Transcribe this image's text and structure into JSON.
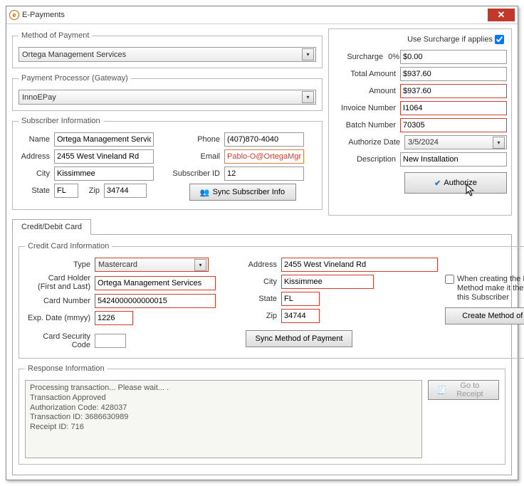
{
  "window": {
    "title": "E-Payments"
  },
  "method": {
    "legend": "Method of Payment",
    "value": "Ortega Management Services"
  },
  "gateway": {
    "legend": "Payment Processor (Gateway)",
    "value": "InnoEPay"
  },
  "subscriber": {
    "legend": "Subscriber Information",
    "name_label": "Name",
    "name": "Ortega Management Servic",
    "address_label": "Address",
    "address": "2455 West Vineland Rd",
    "city_label": "City",
    "city": "Kissimmee",
    "state_label": "State",
    "state": "FL",
    "zip_label": "Zip",
    "zip": "34744",
    "phone_label": "Phone",
    "phone": "(407)870-4040",
    "email_label": "Email",
    "email": "Pablo-O@OrtegaMgmtServ",
    "subid_label": "Subscriber ID",
    "subid": "12",
    "sync_label": "Sync Subscriber Info"
  },
  "surcharge_panel": {
    "use_label": "Use Surcharge if applies",
    "surch_label": "Surcharge",
    "surch_pct": "0%",
    "surch_amt": "$0.00",
    "total_label": "Total Amount",
    "total": "$937.60",
    "amount_label": "Amount",
    "amount": "$937.60",
    "invoice_label": "Invoice Number",
    "invoice": "I1064",
    "batch_label": "Batch Number",
    "batch": "70305",
    "authdate_label": "Authorize Date",
    "authdate": "3/5/2024",
    "desc_label": "Description",
    "desc": "New Installation",
    "authorize_label": "Authorize"
  },
  "tab": {
    "label": "Credit/Debit Card"
  },
  "cc": {
    "legend": "Credit Card Information",
    "type_label": "Type",
    "type": "Mastercard",
    "holder_label": "Card Holder\n(First and Last)",
    "holder": "Ortega Management Services",
    "number_label": "Card Number",
    "number": "5424000000000015",
    "exp_label": "Exp. Date (mmyy)",
    "exp": "1226",
    "csc_label": "Card Security Code",
    "addr_label": "Address",
    "addr": "2455 West Vineland Rd",
    "city_label": "City",
    "city": "Kissimmee",
    "state_label": "State",
    "state": "FL",
    "zip_label": "Zip",
    "zip": "34744",
    "sync_label": "Sync Method of Payment",
    "default_chk_label": "When creating the Payment Method make it the default for this Subscriber",
    "create_label": "Create Method of Payment"
  },
  "response": {
    "legend": "Response Information",
    "text": "Processing transaction... Please wait...    .\nTransaction Approved\nAuthorization Code: 428037\nTransaction ID: 3686630989\nReceipt ID: 716",
    "receipt_btn": "Go to Receipt"
  }
}
